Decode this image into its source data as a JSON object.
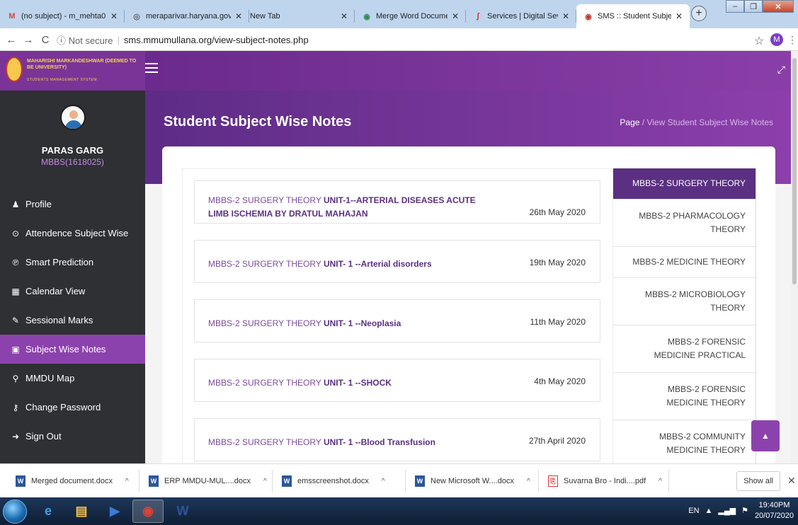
{
  "browser": {
    "tabs": [
      {
        "title": "(no subject) - m_mehta0",
        "icon": "gmail-icon",
        "glyph": "M",
        "color": "#d44638"
      },
      {
        "title": "meraparivar.haryana.gov",
        "icon": "globe-icon",
        "glyph": "◎",
        "color": "#666666"
      },
      {
        "title": "New Tab",
        "icon": "",
        "glyph": "",
        "color": "#666666"
      },
      {
        "title": "Merge Word Documents",
        "icon": "merge-icon",
        "glyph": "◉",
        "color": "#2e8b57"
      },
      {
        "title": "Services | Digital Seva Po",
        "icon": "digital-seva-icon",
        "glyph": "∫",
        "color": "#d62d20"
      },
      {
        "title": "SMS :: Student Subject W",
        "icon": "sms-logo-icon",
        "glyph": "◉",
        "color": "#c0392b"
      }
    ],
    "close_glyph": "✕",
    "new_tab_glyph": "+",
    "window_controls": [
      "–",
      "❐",
      "✕"
    ],
    "nav": {
      "back": "←",
      "forward": "→",
      "reload": "C"
    },
    "url_security": "ⓘ Not secure",
    "url": "sms.mmumullana.org/view-subject-notes.php",
    "star": "☆",
    "profile_initial": "M",
    "menu_glyph": "⋮"
  },
  "app": {
    "logo_text": "MAHARISHI MARKANDESHWAR (DEEMED TO BE UNIVERSITY)",
    "logo_sub": "STUDENTS MANAGEMENT SYSTEM",
    "expand_glyph": "⤢",
    "user": {
      "name": "PARAS GARG",
      "id": "MBBS(1618025)"
    },
    "menu": [
      {
        "label": "Profile",
        "icon": "user-icon",
        "glyph": "♟"
      },
      {
        "label": "Attendence Subject Wise",
        "icon": "clock-icon",
        "glyph": "⊙"
      },
      {
        "label": "Smart Prediction",
        "icon": "pinterest-icon",
        "glyph": "℗"
      },
      {
        "label": "Calendar View",
        "icon": "calendar-icon",
        "glyph": "▦"
      },
      {
        "label": "Sessional Marks",
        "icon": "edit-icon",
        "glyph": "✎"
      },
      {
        "label": "Subject Wise Notes",
        "icon": "notes-icon",
        "glyph": "▣",
        "active": true
      },
      {
        "label": "MMDU Map",
        "icon": "map-marker-icon",
        "glyph": "⚲"
      },
      {
        "label": "Change Password",
        "icon": "key-icon",
        "glyph": "⚷"
      },
      {
        "label": "Sign Out",
        "icon": "sign-out-icon",
        "glyph": "➜"
      }
    ],
    "page_title": "Student Subject Wise Notes",
    "breadcrumb": {
      "page": "Page",
      "sep": " / ",
      "current": "View Student Subject Wise Notes"
    },
    "notes": [
      {
        "prefix": "MBBS-2 SURGERY THEORY ",
        "title": "UNIT-1--ARTERIAL DISEASES ACUTE",
        "title2": "LIMB ISCHEMIA BY DRATUL MAHAJAN",
        "date": "26th May 2020"
      },
      {
        "prefix": "MBBS-2 SURGERY THEORY ",
        "title": "UNIT- 1 --Arterial disorders",
        "title2": "",
        "date": "19th May 2020"
      },
      {
        "prefix": "MBBS-2 SURGERY THEORY ",
        "title": "UNIT- 1 --Neoplasia",
        "title2": "",
        "date": "11th May 2020"
      },
      {
        "prefix": "MBBS-2 SURGERY THEORY ",
        "title": "UNIT- 1 --SHOCK",
        "title2": "",
        "date": "4th May 2020"
      },
      {
        "prefix": "MBBS-2 SURGERY THEORY ",
        "title": "UNIT- 1 --Blood Transfusion",
        "title2": "",
        "date": "27th April 2020"
      }
    ],
    "subjects": [
      {
        "l1": "MBBS-2 SURGERY THEORY",
        "l2": "",
        "active": true
      },
      {
        "l1": "MBBS-2 PHARMACOLOGY",
        "l2": "THEORY"
      },
      {
        "l1": "MBBS-2 MEDICINE THEORY",
        "l2": ""
      },
      {
        "l1": "MBBS-2 MICROBIOLOGY",
        "l2": "THEORY"
      },
      {
        "l1": "MBBS-2 FORENSIC",
        "l2": "MEDICINE PRACTICAL"
      },
      {
        "l1": "MBBS-2 FORENSIC",
        "l2": "MEDICINE THEORY"
      },
      {
        "l1": "MBBS-2 COMMUNITY",
        "l2": "MEDICINE THEORY"
      }
    ],
    "scroll_top_glyph": "▲"
  },
  "downloads": {
    "items": [
      {
        "name": "Merged document.docx",
        "type": "word"
      },
      {
        "name": "ERP MMDU-MUL....docx",
        "type": "word"
      },
      {
        "name": "emsscreenshot.docx",
        "type": "word"
      },
      {
        "name": "New Microsoft W....docx",
        "type": "word"
      },
      {
        "name": "Suvarna Bro - Indi....pdf",
        "type": "pdf"
      }
    ],
    "caret": "^",
    "show_all": "Show all",
    "close": "✕"
  },
  "taskbar": {
    "apps": [
      {
        "name": "internet-explorer",
        "glyph": "e",
        "color": "#3fa0e8"
      },
      {
        "name": "file-explorer",
        "glyph": "▤",
        "color": "#f2c14e"
      },
      {
        "name": "media-player",
        "glyph": "▶",
        "color": "#3a7bd5"
      },
      {
        "name": "chrome",
        "glyph": "◉",
        "color": "#e34133",
        "active": true
      },
      {
        "name": "word",
        "glyph": "W",
        "color": "#2b579a"
      }
    ],
    "lang": "EN",
    "time": "19:40PM",
    "date": "20/07/2020"
  }
}
